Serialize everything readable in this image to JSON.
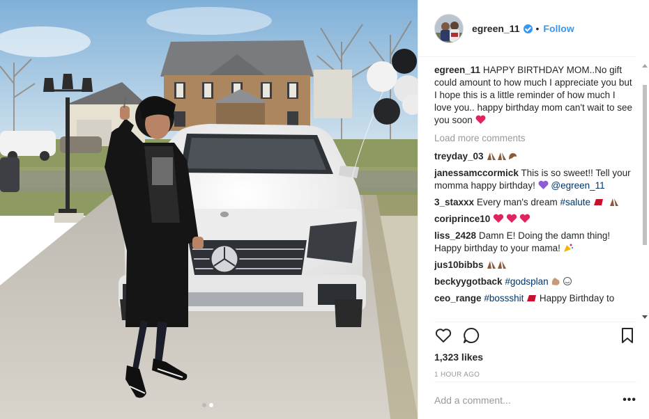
{
  "post": {
    "username": "egreen_11",
    "separator": "•",
    "follow_label": "Follow",
    "avatar_icon": "profile-avatar",
    "verified_icon": "verified-badge-icon"
  },
  "caption": {
    "username": "egreen_11",
    "text": "HAPPY BIRTHDAY MOM..No gift could amount to how much I appreciate you but I hope this is a little reminder of how much I love you.. happy birthday mom can't wait to see you soon",
    "emoji": "red-heart"
  },
  "load_more": "Load more comments",
  "comments": [
    {
      "username": "treyday_03",
      "text": "",
      "emojis": [
        "pray",
        "pray",
        "muscle"
      ]
    },
    {
      "username": "janessamccormick",
      "text": "This is so sweet!! Tell your momma happy birthday!",
      "emoji_after": "purple-heart",
      "tag": "@egreen_11"
    },
    {
      "username": "3_staxxx",
      "text": "Every man's dream",
      "tag": "#salute",
      "emojis": [
        "100",
        "pray"
      ]
    },
    {
      "username": "coriprince10",
      "text": "",
      "emojis": [
        "red-heart",
        "red-heart",
        "red-heart"
      ]
    },
    {
      "username": "liss_2428",
      "text": "Damn E! Doing the damn thing! Happy birthday to your mama!",
      "emojis": [
        "party-popper"
      ]
    },
    {
      "username": "jus10bibbs",
      "text": "",
      "emojis": [
        "pray",
        "pray"
      ]
    },
    {
      "username": "beckyygotback",
      "text": "",
      "tag": "#godsplan",
      "emojis": [
        "clap",
        "smile"
      ]
    },
    {
      "username": "ceo_range",
      "text": "Happy Birthday to",
      "tag": "#bossshit",
      "emojis": [
        "100"
      ]
    }
  ],
  "likes": "1,323 likes",
  "timestamp": "1 HOUR AGO",
  "add_comment": {
    "placeholder": "Add a comment..."
  },
  "more_label": "•••",
  "carousel": {
    "count": 2,
    "active_index": 1
  },
  "colors": {
    "link": "#3897f0",
    "tag": "#003569",
    "muted": "#999999",
    "heart": "#ed4956"
  }
}
